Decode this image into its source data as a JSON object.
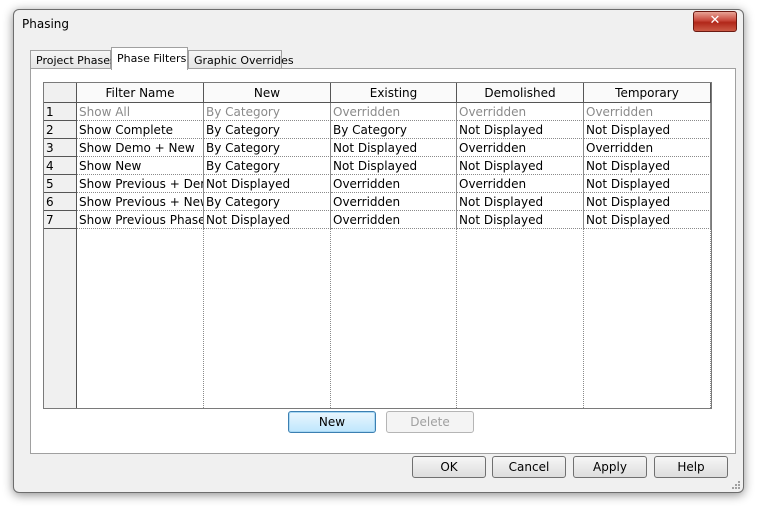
{
  "window": {
    "title": "Phasing",
    "close_glyph": "✕"
  },
  "tabs": [
    {
      "label": "Project Phases",
      "active": false
    },
    {
      "label": "Phase Filters",
      "active": true
    },
    {
      "label": "Graphic Overrides",
      "active": false
    }
  ],
  "table": {
    "headers": [
      "Filter Name",
      "New",
      "Existing",
      "Demolished",
      "Temporary"
    ],
    "rows": [
      {
        "num": "1",
        "cells": [
          "Show All",
          "By Category",
          "Overridden",
          "Overridden",
          "Overridden"
        ],
        "grayed": true
      },
      {
        "num": "2",
        "cells": [
          "Show Complete",
          "By Category",
          "By Category",
          "Not Displayed",
          "Not Displayed"
        ]
      },
      {
        "num": "3",
        "cells": [
          "Show Demo + New",
          "By Category",
          "Not Displayed",
          "Overridden",
          "Overridden"
        ]
      },
      {
        "num": "4",
        "cells": [
          "Show New",
          "By Category",
          "Not Displayed",
          "Not Displayed",
          "Not Displayed"
        ]
      },
      {
        "num": "5",
        "cells": [
          "Show Previous + Demo",
          "Not Displayed",
          "Overridden",
          "Overridden",
          "Not Displayed"
        ]
      },
      {
        "num": "6",
        "cells": [
          "Show Previous + New",
          "By Category",
          "Overridden",
          "Not Displayed",
          "Not Displayed"
        ]
      },
      {
        "num": "7",
        "cells": [
          "Show Previous Phase",
          "Not Displayed",
          "Overridden",
          "Not Displayed",
          "Not Displayed"
        ]
      }
    ]
  },
  "panel_buttons": {
    "new_label": "New",
    "delete_label": "Delete"
  },
  "footer": {
    "ok_label": "OK",
    "cancel_label": "Cancel",
    "apply_label": "Apply",
    "help_label": "Help"
  },
  "icons": {
    "close": "close-icon",
    "resize": "resize-grip-icon"
  }
}
